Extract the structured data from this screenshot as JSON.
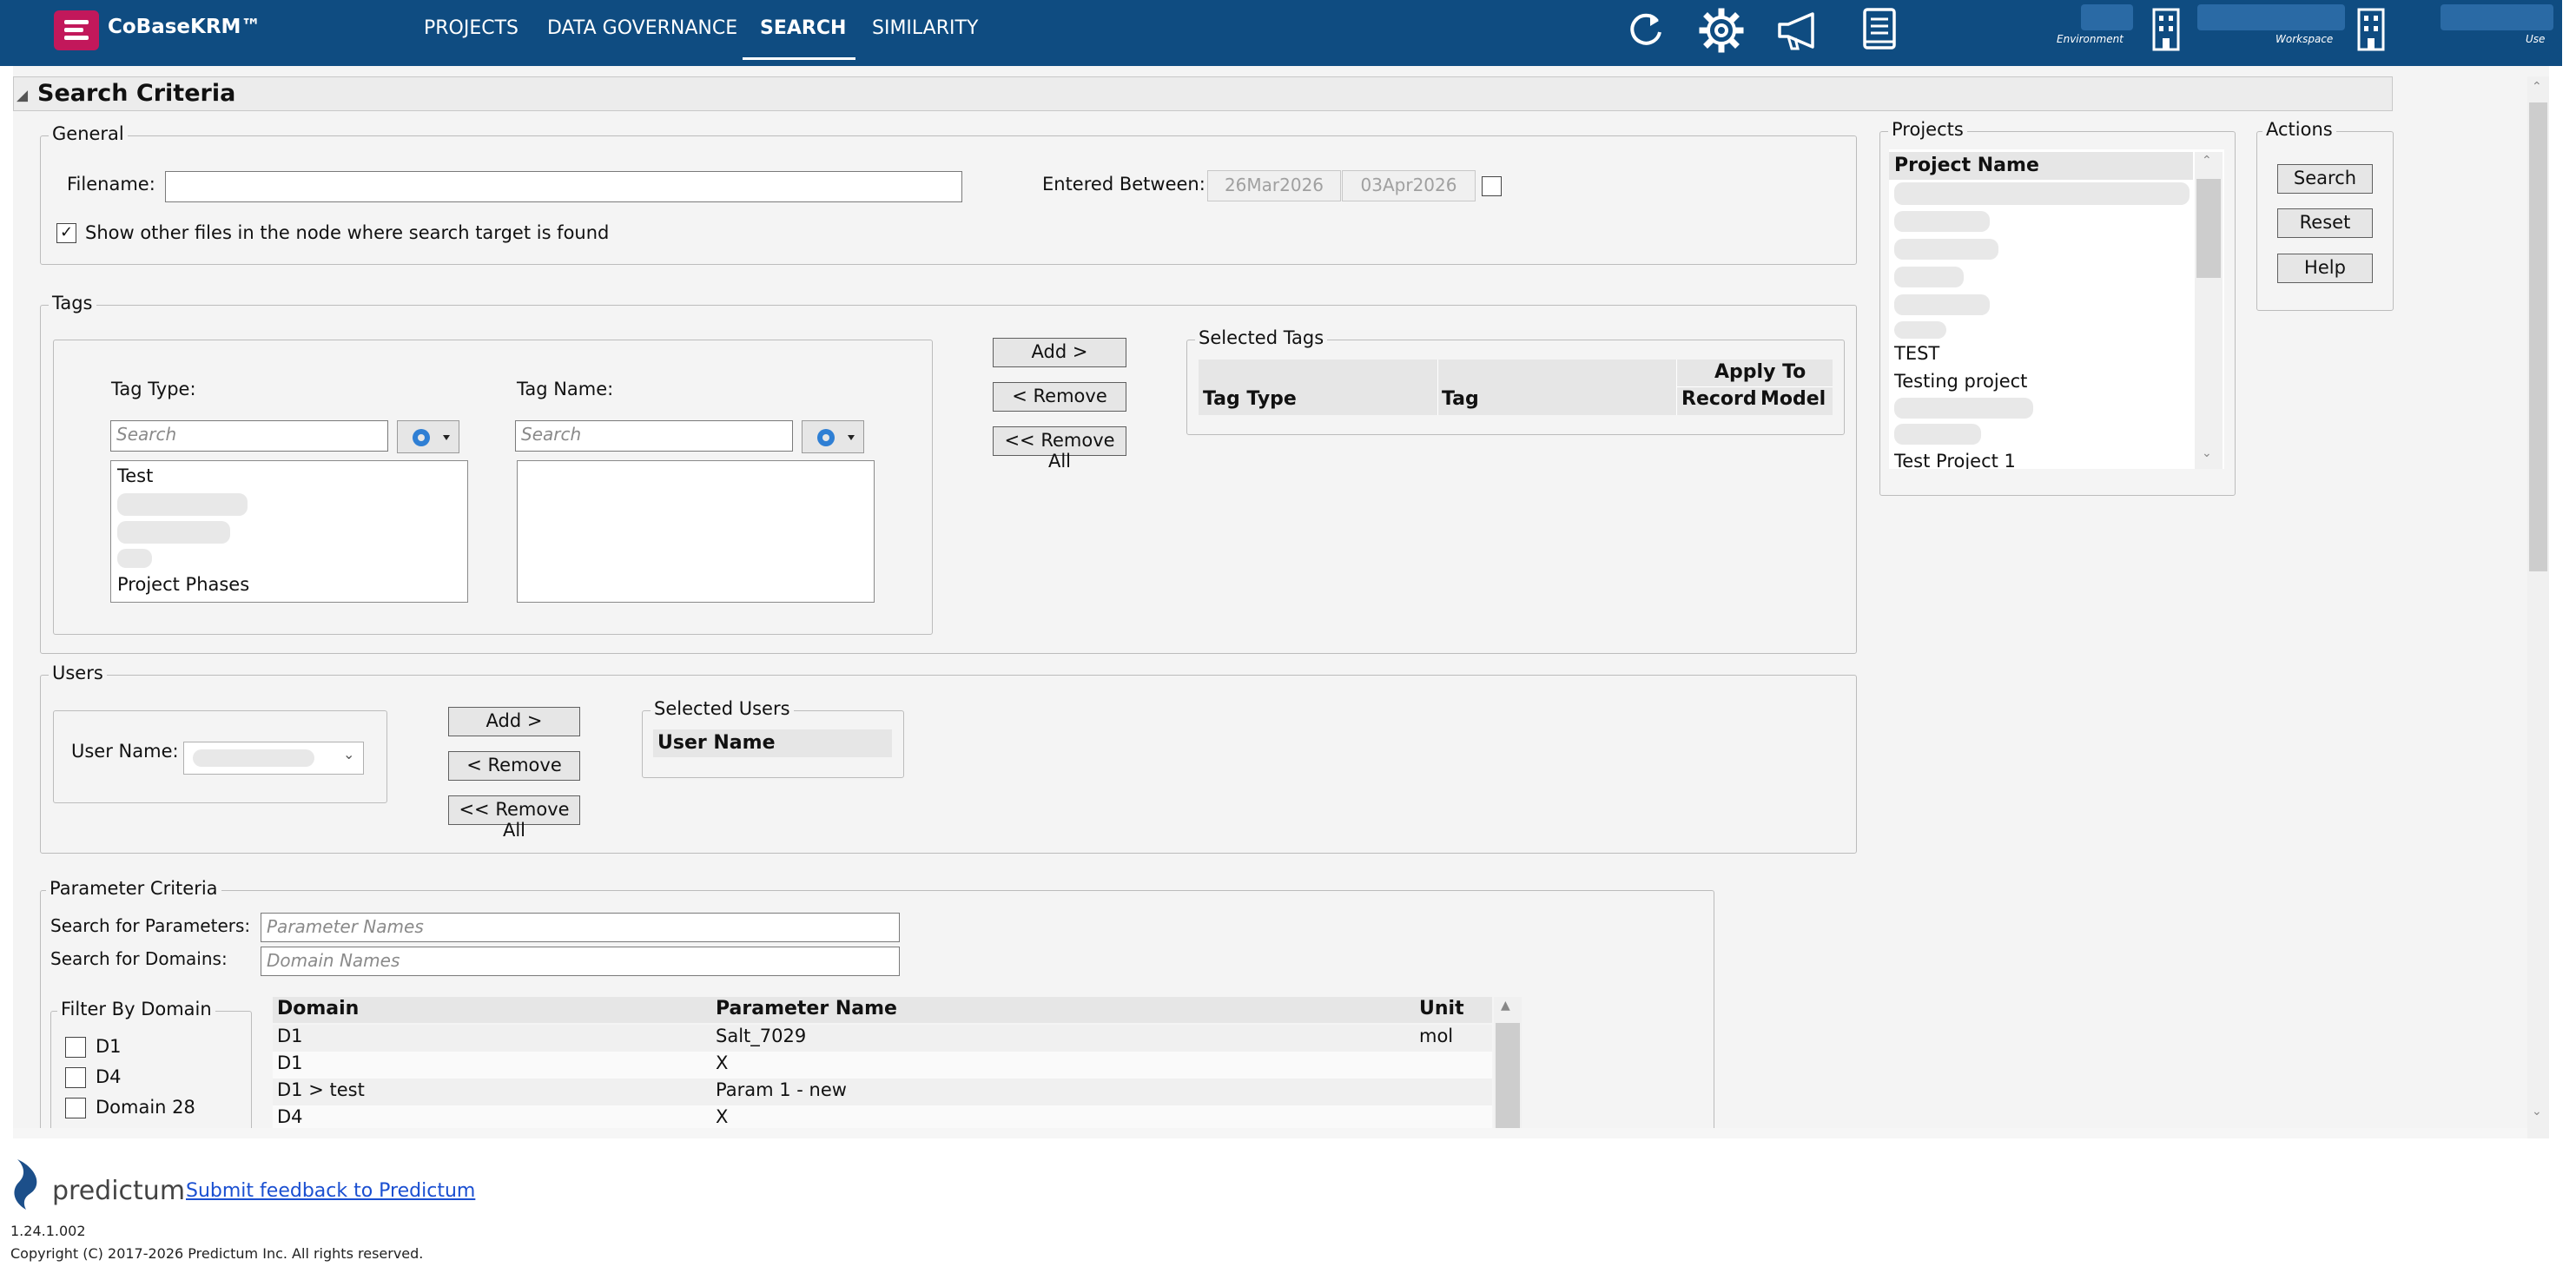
{
  "app": {
    "brand": "CoBaseKRM™"
  },
  "nav": {
    "projects": "PROJECTS",
    "data_governance": "DATA GOVERNANCE",
    "search": "SEARCH",
    "similarity": "SIMILARITY"
  },
  "header_labels": {
    "environment": "Environment",
    "workspace": "Workspace",
    "user": "Use"
  },
  "icons": {
    "refresh": "refresh-icon",
    "settings": "gear-icon",
    "announce": "megaphone-icon",
    "docs": "book-icon",
    "env": "building-icon",
    "ws": "building-icon"
  },
  "search_criteria": {
    "title": "Search Criteria"
  },
  "general": {
    "legend": "General",
    "filename_label": "Filename:",
    "filename_value": "",
    "entered_between_label": "Entered Between:",
    "date_from": "26Mar2026",
    "date_to": "03Apr2026",
    "show_other_files_label": "Show other files in the node where search target is found"
  },
  "tags": {
    "legend": "Tags",
    "tag_type_label": "Tag Type:",
    "tag_name_label": "Tag Name:",
    "tag_type_placeholder": "Search",
    "tag_name_placeholder": "Search",
    "tag_type_items": [
      "Test",
      "Project Phases"
    ],
    "add_btn": "Add >",
    "remove_btn": "< Remove",
    "remove_all_btn": "<< Remove All",
    "selected_legend": "Selected Tags",
    "col_tag_type": "Tag Type",
    "col_tag": "Tag",
    "col_apply_to": "Apply To",
    "col_record": "Record",
    "col_model": "Model"
  },
  "users": {
    "legend": "Users",
    "user_name_label": "User Name:",
    "add_btn": "Add >",
    "remove_btn": "< Remove",
    "remove_all_btn": "<< Remove All",
    "selected_legend": "Selected Users",
    "col_user_name": "User Name"
  },
  "parameters": {
    "legend": "Parameter Criteria",
    "search_params_label": "Search for Parameters:",
    "search_params_placeholder": "Parameter Names",
    "search_domains_label": "Search for Domains:",
    "search_domains_placeholder": "Domain Names",
    "filter_legend": "Filter By Domain",
    "filter_items": [
      "D1",
      "D4",
      "Domain 28"
    ],
    "col_domain": "Domain",
    "col_param": "Parameter Name",
    "col_unit": "Unit",
    "rows": [
      {
        "domain": "D1",
        "param": "Salt_7029",
        "unit": "mol"
      },
      {
        "domain": "D1",
        "param": "X",
        "unit": ""
      },
      {
        "domain": "D1 > test",
        "param": "Param 1  - new",
        "unit": ""
      },
      {
        "domain": "D4",
        "param": "X",
        "unit": ""
      }
    ]
  },
  "projects": {
    "legend": "Projects",
    "col_project_name": "Project Name",
    "items": [
      "TEST",
      "Testing project",
      "Test Project 1"
    ]
  },
  "actions": {
    "legend": "Actions",
    "search": "Search",
    "reset": "Reset",
    "help": "Help"
  },
  "footer": {
    "logo_text": "predictum",
    "feedback_link": "Submit feedback to Predictum",
    "version": "1.24.1.002",
    "copyright": "Copyright (C) 2017-2026 Predictum Inc. All rights reserved."
  }
}
